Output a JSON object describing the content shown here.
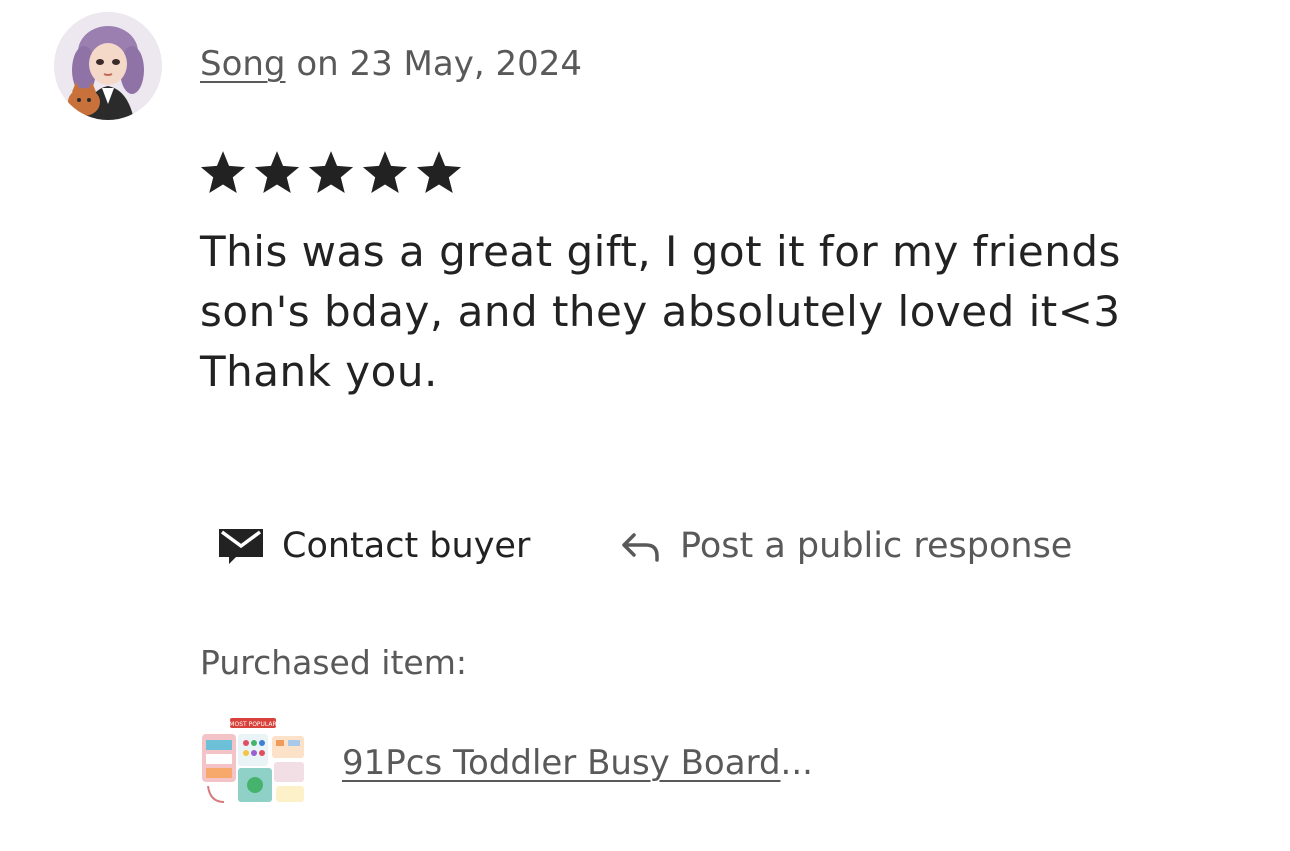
{
  "review": {
    "reviewer_name": "Song",
    "date_text": " on 23 May, 2024",
    "rating": 5,
    "rating_max": 5,
    "text": "This was a great gift, I got it for my friends son's bday, and they absolutely loved it<3 Thank you."
  },
  "actions": {
    "contact_label": "Contact buyer",
    "contact_icon": "envelope-icon",
    "post_label": "Post a public response",
    "post_icon": "reply-arrow-icon"
  },
  "purchase": {
    "label": "Purchased item:",
    "item_title": "91Pcs Toddler Busy Board",
    "item_ellipsis": "...",
    "thumb_badge": "MOST POPULAR"
  },
  "colors": {
    "text_primary": "#222222",
    "text_secondary": "#595959",
    "star": "#222222"
  }
}
